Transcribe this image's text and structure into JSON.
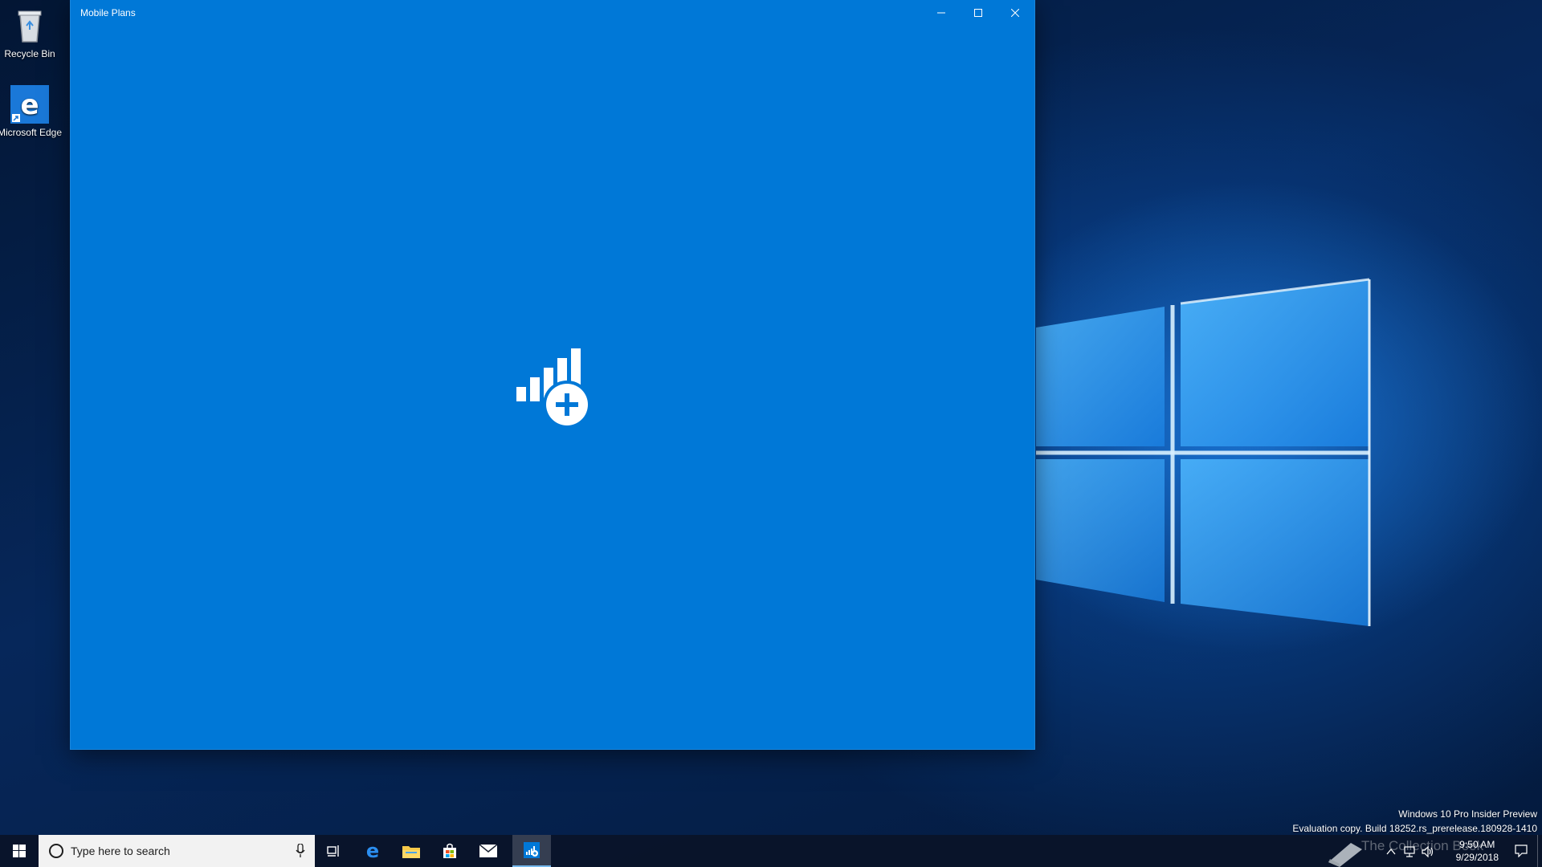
{
  "desktop": {
    "icons": [
      {
        "label": "Recycle Bin",
        "icon": "recycle-bin-icon"
      },
      {
        "label": "Microsoft Edge",
        "icon": "edge-icon"
      }
    ]
  },
  "window": {
    "title": "Mobile Plans",
    "splash_icon": "mobile-plans-signal-plus-icon",
    "background_color": "#0078d7",
    "controls": {
      "minimize": "minimize-icon",
      "maximize": "maximize-icon",
      "close": "close-icon"
    }
  },
  "watermark": {
    "line1": "Windows 10 Pro Insider Preview",
    "line2": "Evaluation copy. Build 18252.rs_prerelease.180928-1410"
  },
  "taskbar": {
    "search_placeholder": "Type here to search",
    "pinned": [
      "task-view-icon",
      "edge-icon",
      "file-explorer-icon",
      "store-icon",
      "mail-icon",
      "mobile-plans-icon"
    ],
    "clock_time": "9:50 AM",
    "clock_date": "9/29/2018",
    "overlay_logo_text": "The Collection Book"
  }
}
